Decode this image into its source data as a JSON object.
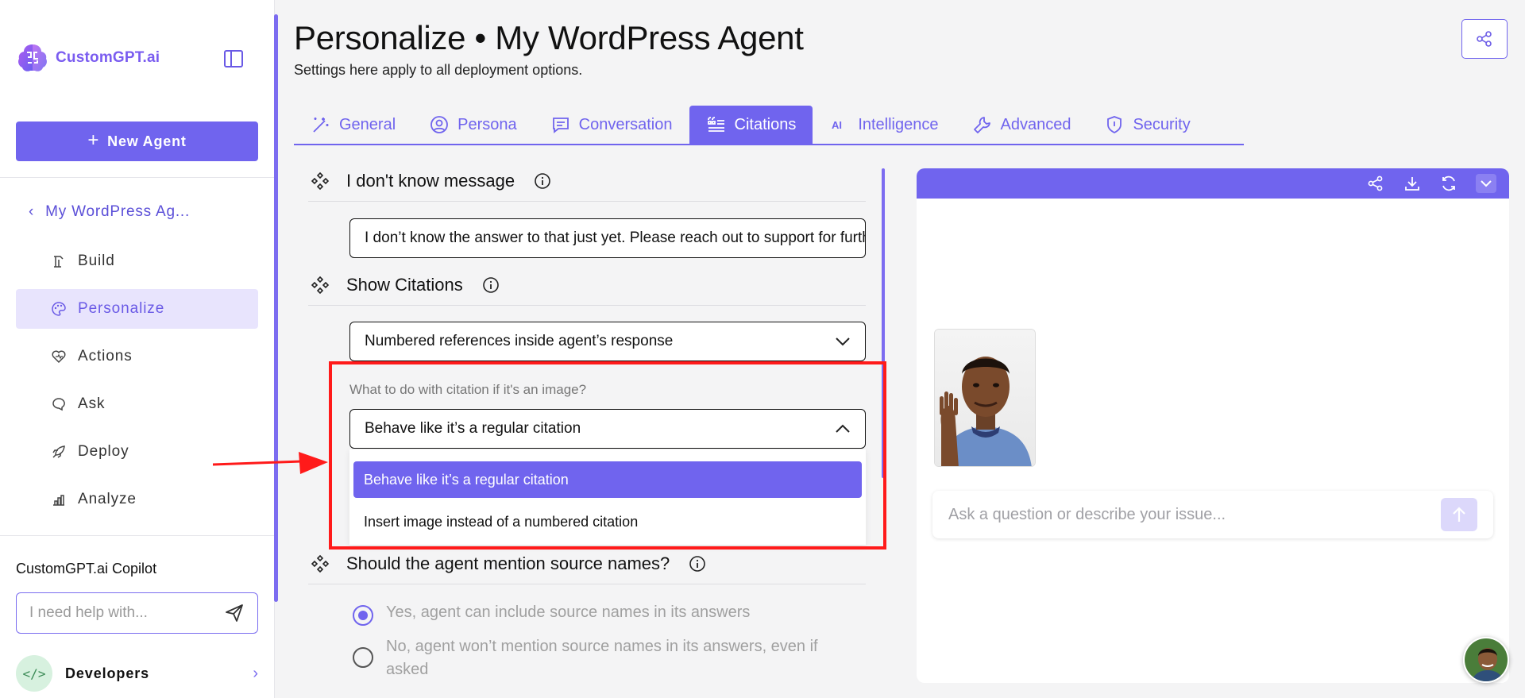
{
  "brand": {
    "name": "CustomGPT.ai"
  },
  "sidebar": {
    "new_agent_label": "New Agent",
    "agent_name": "My WordPress Ag...",
    "items": [
      {
        "label": "Build",
        "icon": "build-icon"
      },
      {
        "label": "Personalize",
        "icon": "palette-icon"
      },
      {
        "label": "Actions",
        "icon": "actions-icon"
      },
      {
        "label": "Ask",
        "icon": "chat-icon"
      },
      {
        "label": "Deploy",
        "icon": "rocket-icon"
      },
      {
        "label": "Analyze",
        "icon": "chart-icon"
      }
    ],
    "active_item": "Personalize",
    "copilot": {
      "title": "CustomGPT.ai Copilot",
      "placeholder": "I need help with..."
    },
    "developers_label": "Developers"
  },
  "header": {
    "title": "Personalize • My WordPress Agent",
    "subtitle": "Settings here apply to all deployment options."
  },
  "tabs": [
    {
      "label": "General",
      "icon": "wand-icon"
    },
    {
      "label": "Persona",
      "icon": "user-circle-icon"
    },
    {
      "label": "Conversation",
      "icon": "message-icon"
    },
    {
      "label": "Citations",
      "icon": "citations-icon"
    },
    {
      "label": "Intelligence",
      "icon": "ai-icon"
    },
    {
      "label": "Advanced",
      "icon": "wrench-icon"
    },
    {
      "label": "Security",
      "icon": "shield-icon"
    }
  ],
  "active_tab": "Citations",
  "settings": {
    "idk": {
      "title": "I don't know message",
      "value": "I don’t know the answer to that just yet. Please reach out to support for further help."
    },
    "citations": {
      "title": "Show Citations",
      "value": "Numbered references inside agent’s response"
    },
    "image_citation": {
      "label": "What to do with citation if it's an image?",
      "value": "Behave like it’s a regular citation",
      "options": [
        "Behave like it’s a regular citation",
        "Insert image instead of a numbered citation"
      ]
    },
    "source_names": {
      "title": "Should the agent mention source names?",
      "options": [
        "Yes, agent can include source names in its answers",
        "No, agent won’t mention source names in its answers, even if asked"
      ],
      "selected_index": 0
    }
  },
  "preview": {
    "input_placeholder": "Ask a question or describe your issue..."
  },
  "colors": {
    "accent": "#7064ee",
    "highlight": "#ff1a1a"
  }
}
